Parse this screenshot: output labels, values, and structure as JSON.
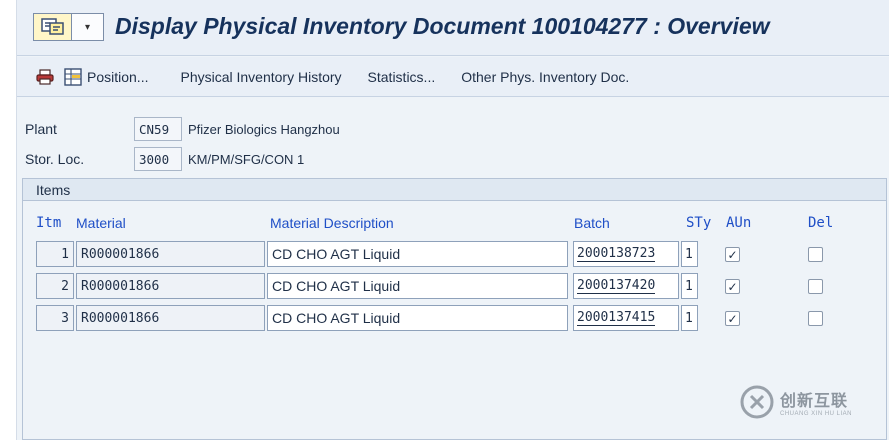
{
  "title": "Display Physical Inventory Document 100104277 : Overview",
  "toolbar": {
    "position_label": "Position...",
    "history_label": "Physical Inventory History",
    "statistics_label": "Statistics...",
    "other_doc_label": "Other Phys. Inventory Doc."
  },
  "header": {
    "plant_label": "Plant",
    "plant_code": "CN59",
    "plant_name": "Pfizer Biologics Hangzhou",
    "storloc_label": "Stor. Loc.",
    "storloc_code": "3000",
    "storloc_name": "KM/PM/SFG/CON 1"
  },
  "items": {
    "section_title": "Items",
    "columns": {
      "itm": "Itm",
      "material": "Material",
      "description": "Material Description",
      "batch": "Batch",
      "sty": "STy",
      "aun": "AUn",
      "del": "Del"
    },
    "rows": [
      {
        "itm": "1",
        "material": "R000001866",
        "description": "CD CHO AGT Liquid",
        "batch": "2000138723",
        "sty": "1",
        "aun": true,
        "del": false
      },
      {
        "itm": "2",
        "material": "R000001866",
        "description": "CD CHO AGT Liquid",
        "batch": "2000137420",
        "sty": "1",
        "aun": true,
        "del": false
      },
      {
        "itm": "3",
        "material": "R000001866",
        "description": "CD CHO AGT Liquid",
        "batch": "2000137415",
        "sty": "1",
        "aun": true,
        "del": false
      }
    ]
  },
  "watermark": {
    "cn": "创新互联",
    "en": "CHUANG XIN HU LIAN"
  },
  "colors": {
    "title": "#16325c",
    "column_header": "#1f4fc7",
    "background": "#eef3f8"
  }
}
